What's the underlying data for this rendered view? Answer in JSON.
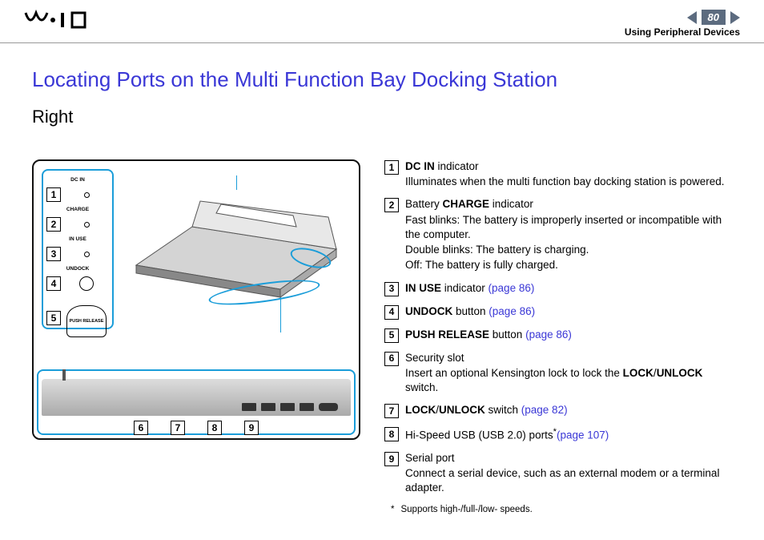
{
  "header": {
    "page_number": "80",
    "section": "Using Peripheral Devices",
    "logo_alt": "VAIO"
  },
  "title": "Locating Ports on the Multi Function Bay Docking Station",
  "subtitle": "Right",
  "panel": {
    "dc_in": "DC IN",
    "charge": "CHARGE",
    "in_use": "IN USE",
    "undock": "UNDOCK",
    "push_release": "PUSH RELEASE"
  },
  "numbers": {
    "n1": "1",
    "n2": "2",
    "n3": "3",
    "n4": "4",
    "n5": "5",
    "n6": "6",
    "n7": "7",
    "n8": "8",
    "n9": "9"
  },
  "legend": {
    "i1_title_a": "DC IN",
    "i1_title_b": " indicator",
    "i1_desc": "Illuminates when the multi function bay docking station is powered.",
    "i2_a": "Battery ",
    "i2_b": "CHARGE",
    "i2_c": " indicator",
    "i2_l1": "Fast blinks: The battery is improperly inserted or incompatible with the computer.",
    "i2_l2": "Double blinks: The battery is charging.",
    "i2_l3": "Off: The battery is fully charged.",
    "i3_a": "IN USE",
    "i3_b": " indicator ",
    "i3_link": "(page 86)",
    "i4_a": "UNDOCK",
    "i4_b": " button ",
    "i4_link": "(page 86)",
    "i5_a": "PUSH RELEASE",
    "i5_b": " button ",
    "i5_link": "(page 86)",
    "i6_a": "Security slot",
    "i6_desc_a": "Insert an optional Kensington lock to lock the ",
    "i6_desc_b": "LOCK",
    "i6_desc_c": "/",
    "i6_desc_d": "UNLOCK",
    "i6_desc_e": " switch.",
    "i7_a": "LOCK",
    "i7_b": "/",
    "i7_c": "UNLOCK",
    "i7_d": " switch ",
    "i7_link": "(page 82)",
    "i8_a": "Hi-Speed USB (USB 2.0) ports",
    "i8_ast": "*",
    "i8_link": "(page 107)",
    "i9_a": "Serial port",
    "i9_desc": "Connect a serial device, such as an external modem or a terminal adapter.",
    "footnote_ast": "*",
    "footnote": "Supports high-/full-/low- speeds."
  }
}
